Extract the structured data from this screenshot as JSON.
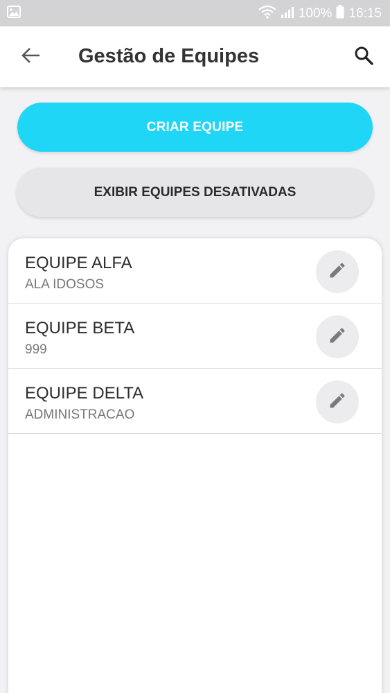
{
  "status_bar": {
    "battery": "100%",
    "time": "16:15",
    "icons": [
      "image-icon",
      "wifi-icon",
      "signal-icon",
      "battery-icon"
    ]
  },
  "app_bar": {
    "title": "Gestão de Equipes",
    "icons": [
      "arrow-back-icon",
      "search-icon"
    ]
  },
  "actions": {
    "create_label": "CRIAR EQUIPE",
    "show_disabled_label": "EXIBIR EQUIPES DESATIVADAS"
  },
  "teams": [
    {
      "name": "EQUIPE ALFA",
      "sector": "ALA IDOSOS"
    },
    {
      "name": "EQUIPE BETA",
      "sector": "999"
    },
    {
      "name": "EQUIPE DELTA",
      "sector": "ADMINISTRACAO"
    }
  ],
  "colors": {
    "primary": "#1fd6f7",
    "secondary_button": "#e6e6e8",
    "status_bar": "#d3d3d6",
    "background": "#f2f2f4"
  }
}
